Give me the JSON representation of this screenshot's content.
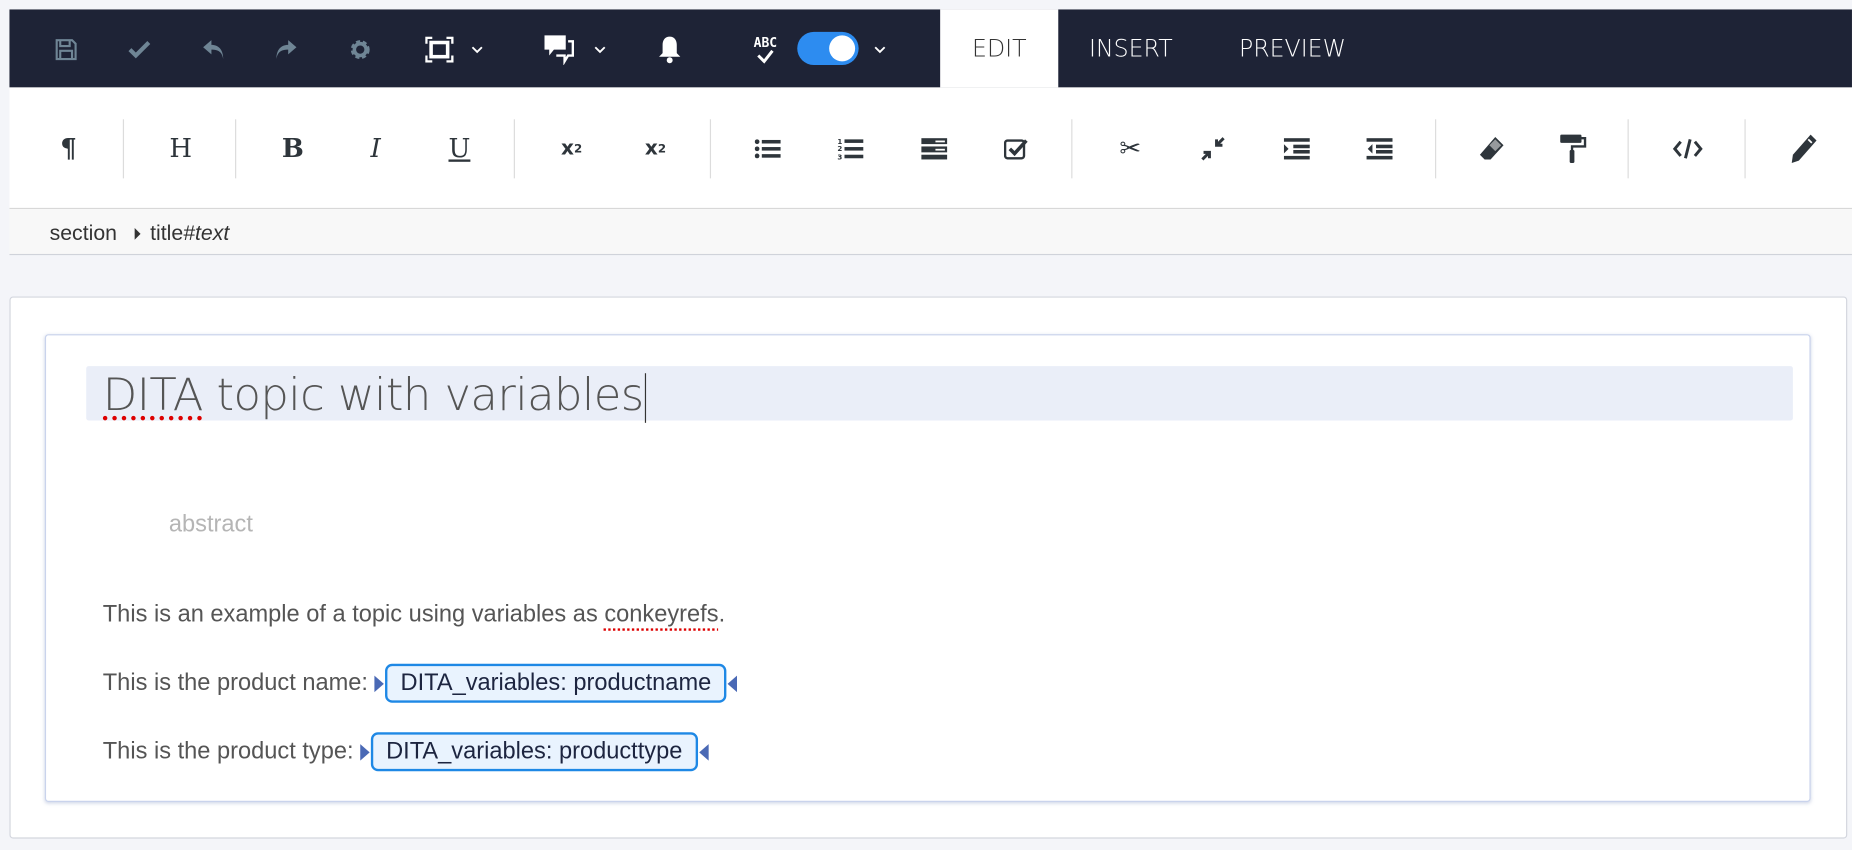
{
  "topbar": {
    "icons": [
      "save-icon",
      "check-icon",
      "undo-icon",
      "redo-icon",
      "gear-icon",
      "fullscreen-icon",
      "comments-icon",
      "bell-icon",
      "spellcheck-icon"
    ],
    "spellcheck_label": "ABC",
    "spellcheck_enabled": true,
    "tabs": [
      {
        "label": "EDIT",
        "active": true
      },
      {
        "label": "INSERT",
        "active": false
      },
      {
        "label": "PREVIEW",
        "active": false
      }
    ]
  },
  "toolbar": {
    "paragraph": "¶",
    "heading": "H",
    "bold": "B",
    "italic": "I",
    "underline": "U"
  },
  "breadcrumb": {
    "items": [
      "section",
      "title"
    ],
    "suffix": "#text"
  },
  "document": {
    "title_spell": "DITA",
    "title_rest": " topic with variables",
    "abstract_placeholder": "abstract",
    "para1_prefix": "This is an example of a topic using variables as ",
    "para1_spell": "conkeyrefs",
    "para1_suffix": ".",
    "para2_label": "This is the product name: ",
    "para2_var": "DITA_variables: productname",
    "para3_label": "This is the product type: ",
    "para3_var": "DITA_variables: producttype"
  },
  "colors": {
    "topbar_bg": "#1e2336",
    "toggle_on": "#2d8cf0",
    "var_border": "#1e88e5",
    "var_bg": "#e9f3fe"
  }
}
